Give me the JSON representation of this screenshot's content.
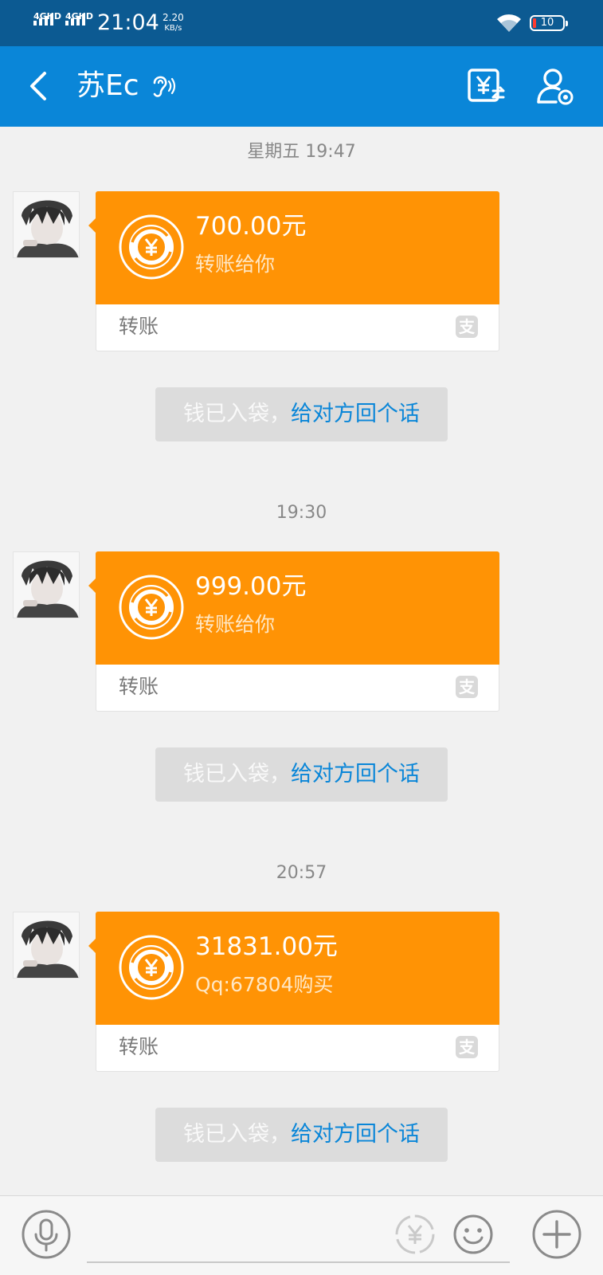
{
  "status_bar": {
    "sim1_label": "4GHD",
    "sim2_label": "4GHD",
    "time": "21:04",
    "speed_value": "2.20",
    "speed_unit": "KB/s",
    "battery": "10"
  },
  "header": {
    "title": "苏Ec",
    "icons": [
      "back-icon",
      "ear-icon",
      "transfer-icon",
      "profile-settings-icon"
    ]
  },
  "messages": [
    {
      "time": "星期五 19:47",
      "amount": "700.00元",
      "memo": "转账给你",
      "footer_label": "转账",
      "notice_prefix": "钱已入袋，",
      "notice_link": "给对方回个话"
    },
    {
      "time": "19:30",
      "amount": "999.00元",
      "memo": "转账给你",
      "footer_label": "转账",
      "notice_prefix": "钱已入袋，",
      "notice_link": "给对方回个话"
    },
    {
      "time": "20:57",
      "amount": "31831.00元",
      "memo": "Qq:67804购买",
      "footer_label": "转账",
      "notice_prefix": "钱已入袋，",
      "notice_link": "给对方回个话"
    }
  ],
  "input_bar": {
    "icons": [
      "microphone-icon",
      "red-packet-icon",
      "emoji-icon",
      "plus-icon"
    ]
  },
  "colors": {
    "status_bar": "#0c5a92",
    "title_bar": "#0a86d8",
    "transfer_card": "#ff9305",
    "link": "#0a86d8",
    "background": "#f1f1f1"
  }
}
